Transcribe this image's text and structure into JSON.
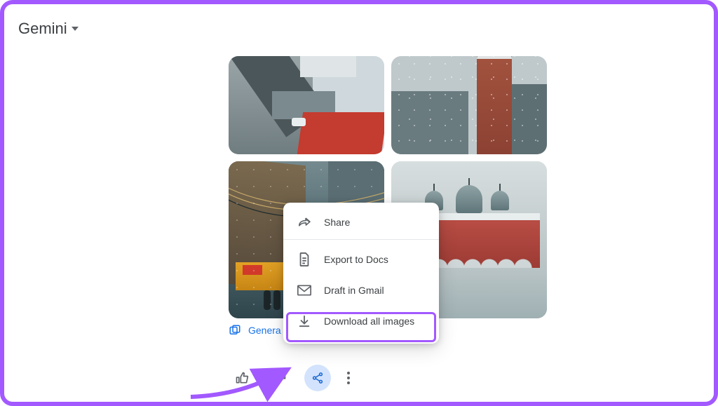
{
  "accent": "#a259ff",
  "app": {
    "title": "Gemini"
  },
  "share_menu": {
    "items": [
      {
        "label": "Share"
      },
      {
        "label": "Export to Docs"
      },
      {
        "label": "Draft in Gmail"
      },
      {
        "label": "Download all images"
      }
    ]
  },
  "generate_row": {
    "label_truncated": "Genera"
  },
  "images": {
    "count": 4
  }
}
